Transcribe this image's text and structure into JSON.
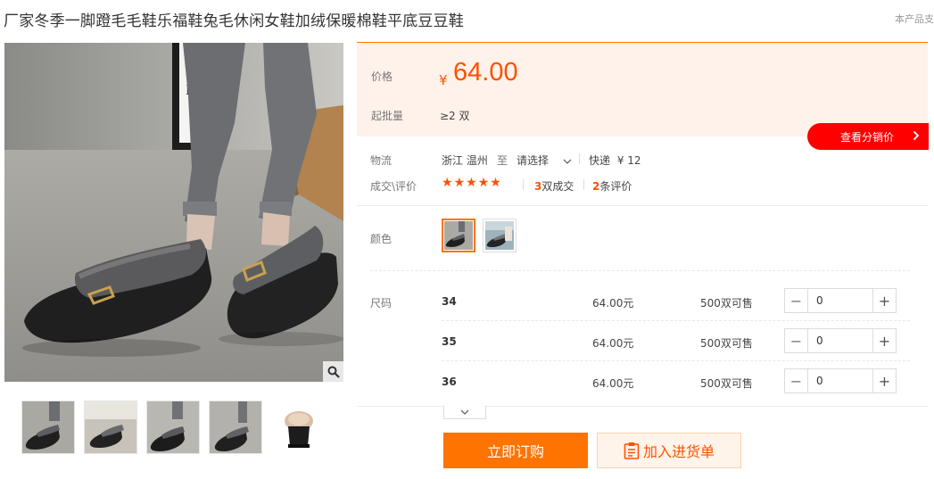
{
  "product": {
    "title": "厂家冬季一脚蹬毛毛鞋乐福鞋兔毛休闲女鞋加绒保暖棉鞋平底豆豆鞋",
    "source_tag": "本产品支"
  },
  "gallery": {
    "main_image": "fur-loafer-main-photo",
    "thumbnail_count": 5
  },
  "price": {
    "label": "价格",
    "currency": "¥",
    "value": "64.00",
    "moq_label": "起批量",
    "moq_value": "≥2 双"
  },
  "distributor_button": "查看分销价",
  "logistics": {
    "label": "物流",
    "origin": "浙江 温州",
    "to": "至",
    "destination": "请选择",
    "method": "快递",
    "fee": "¥ 12"
  },
  "reviews": {
    "label": "成交\\评价",
    "rating_stars": 5,
    "deals_count": "3",
    "deals_unit": "双成交",
    "reviews_count": "2",
    "reviews_unit": "条评价"
  },
  "color": {
    "label": "颜色",
    "selected_index": 0,
    "option_count": 2
  },
  "size": {
    "label": "尺码",
    "rows": [
      {
        "size": "34",
        "price": "64.00元",
        "stock": "500双可售",
        "qty": "0"
      },
      {
        "size": "35",
        "price": "64.00元",
        "stock": "500双可售",
        "qty": "0"
      },
      {
        "size": "36",
        "price": "64.00元",
        "stock": "500双可售",
        "qty": "0"
      }
    ]
  },
  "actions": {
    "order_now": "立即订购",
    "add_to_list": "加入进货单"
  },
  "colors": {
    "accent": "#ff7300",
    "price": "#ff5000",
    "distributor_red": "#ff0000",
    "panel_bg": "#fff2ea"
  }
}
